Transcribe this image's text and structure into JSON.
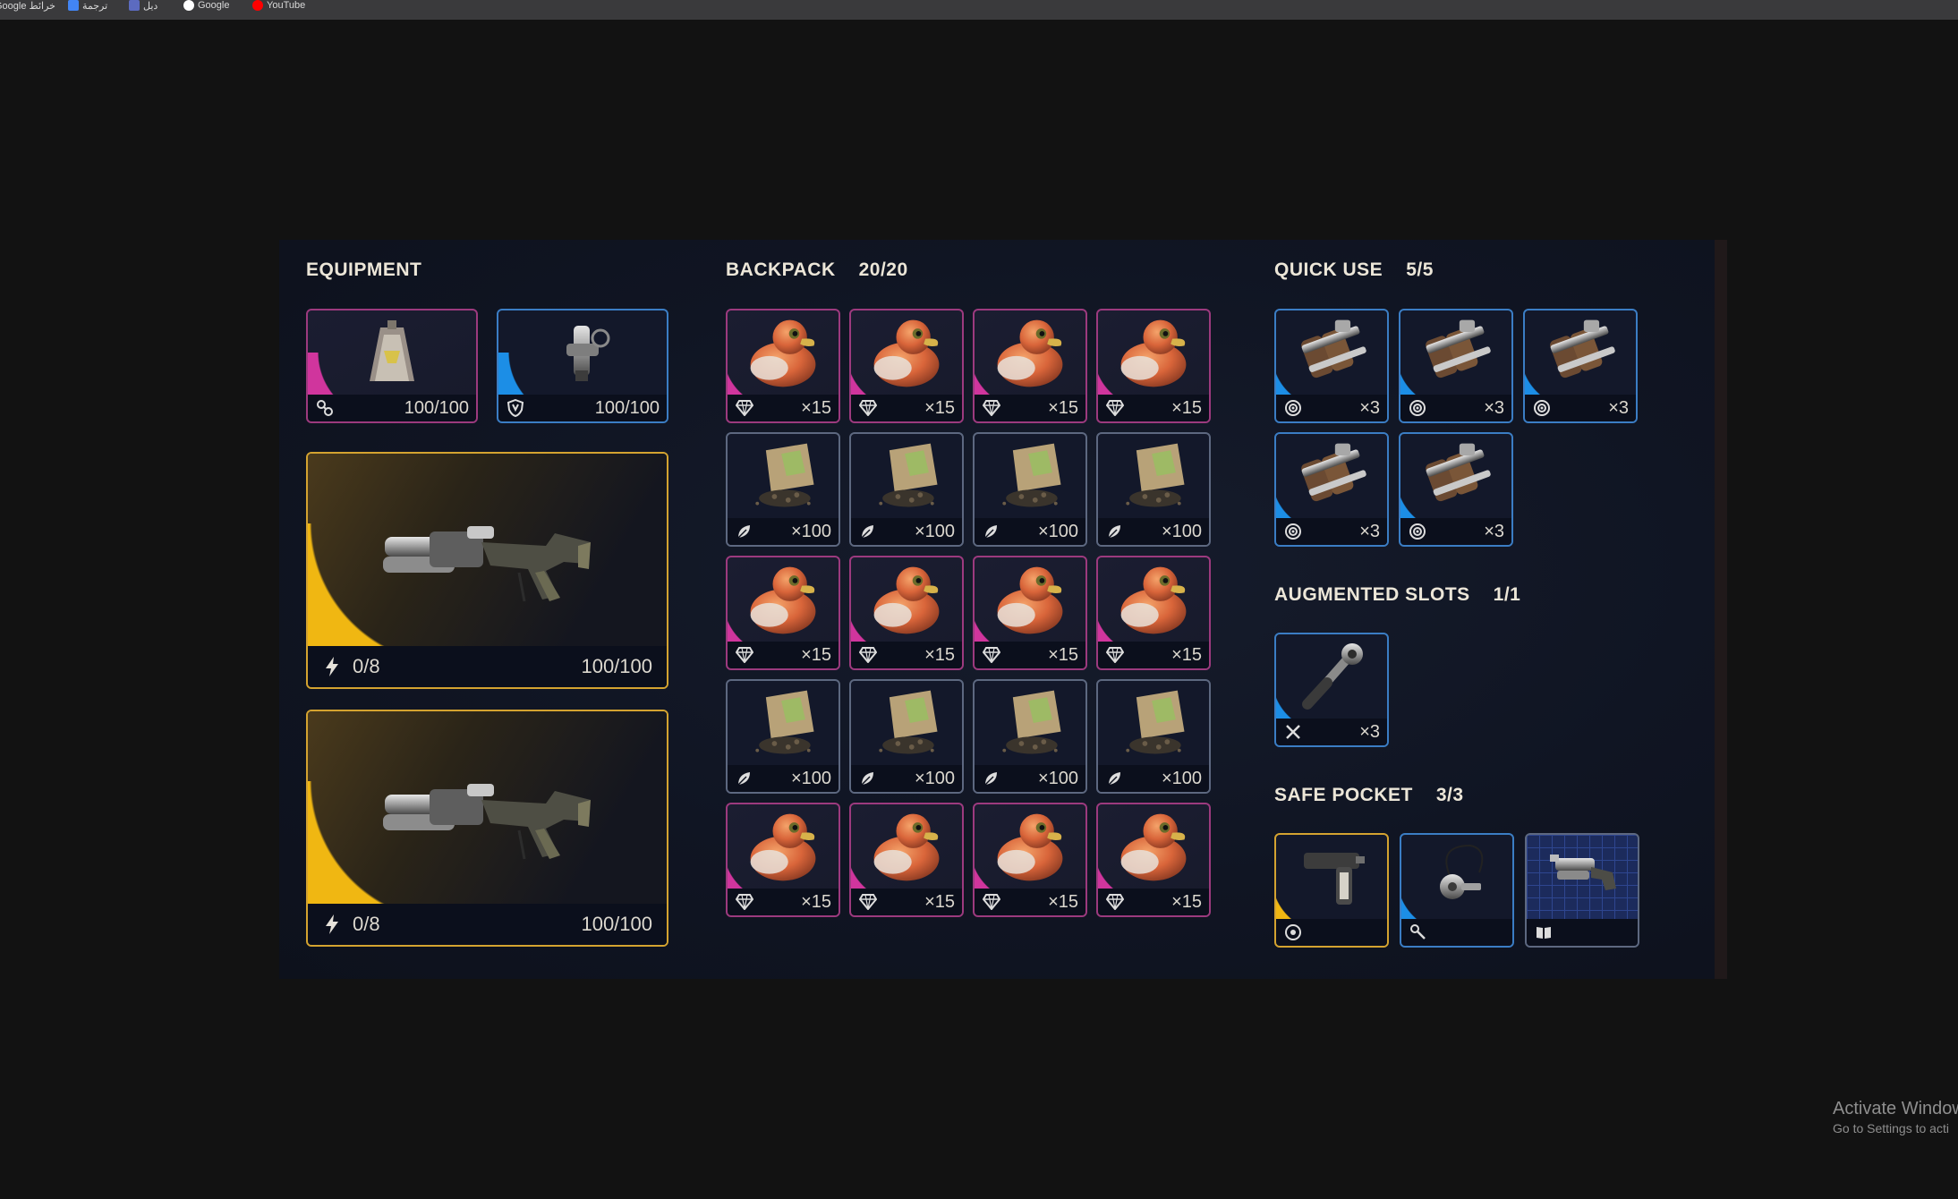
{
  "bookmarks": [
    {
      "label": "Google خرائط",
      "icon": "maps-icon",
      "color": "#4caf50"
    },
    {
      "label": "ترجمة",
      "icon": "translate-icon",
      "color": "#4285f4"
    },
    {
      "label": "ديل",
      "icon": "bookmark-icon",
      "color": "#5c6bc0"
    },
    {
      "label": "Google",
      "icon": "google-icon",
      "color": "#ffffff"
    },
    {
      "label": "YouTube",
      "icon": "youtube-icon",
      "color": "#ff0000"
    }
  ],
  "equipment": {
    "title": "EQUIPMENT",
    "augment": {
      "value": "100/100",
      "icon": "augment-icon",
      "rarity": "pink"
    },
    "shield": {
      "value": "100/100",
      "icon": "shield-icon",
      "rarity": "blue"
    },
    "weapons": [
      {
        "ammo": "0/8",
        "durability": "100/100",
        "icon": "lightning-icon",
        "rarity": "gold"
      },
      {
        "ammo": "0/8",
        "durability": "100/100",
        "icon": "lightning-icon",
        "rarity": "gold"
      }
    ]
  },
  "backpack": {
    "title": "BACKPACK",
    "count": "20/20",
    "rows": [
      [
        {
          "item": "rubber-duck",
          "qty": "×15"
        },
        {
          "item": "rubber-duck",
          "qty": "×15"
        },
        {
          "item": "rubber-duck",
          "qty": "×15"
        },
        {
          "item": "rubber-duck",
          "qty": "×15"
        }
      ],
      [
        {
          "item": "seed-bag",
          "qty": "×100"
        },
        {
          "item": "seed-bag",
          "qty": "×100"
        },
        {
          "item": "seed-bag",
          "qty": "×100"
        },
        {
          "item": "seed-bag",
          "qty": "×100"
        }
      ],
      [
        {
          "item": "rubber-duck",
          "qty": "×15"
        },
        {
          "item": "rubber-duck",
          "qty": "×15"
        },
        {
          "item": "rubber-duck",
          "qty": "×15"
        },
        {
          "item": "rubber-duck",
          "qty": "×15"
        }
      ],
      [
        {
          "item": "seed-bag",
          "qty": "×100"
        },
        {
          "item": "seed-bag",
          "qty": "×100"
        },
        {
          "item": "seed-bag",
          "qty": "×100"
        },
        {
          "item": "seed-bag",
          "qty": "×100"
        }
      ],
      [
        {
          "item": "rubber-duck",
          "qty": "×15"
        },
        {
          "item": "rubber-duck",
          "qty": "×15"
        },
        {
          "item": "rubber-duck",
          "qty": "×15"
        },
        {
          "item": "rubber-duck",
          "qty": "×15"
        }
      ]
    ]
  },
  "quick_use": {
    "title": "QUICK USE",
    "count": "5/5",
    "items": [
      {
        "item": "grenade-pack",
        "qty": "×3"
      },
      {
        "item": "grenade-pack",
        "qty": "×3"
      },
      {
        "item": "grenade-pack",
        "qty": "×3"
      },
      {
        "item": "grenade-pack",
        "qty": "×3"
      },
      {
        "item": "grenade-pack",
        "qty": "×3"
      }
    ]
  },
  "augmented_slots": {
    "title": "AUGMENTED SLOTS",
    "count": "1/1",
    "items": [
      {
        "item": "wrench-tool",
        "qty": "×3"
      }
    ]
  },
  "safe_pocket": {
    "title": "SAFE POCKET",
    "count": "3/3",
    "items": [
      {
        "item": "pistol",
        "rarity": "gold",
        "icon": "ammo-icon"
      },
      {
        "item": "key",
        "rarity": "blue",
        "icon": "key-icon"
      },
      {
        "item": "blueprint",
        "rarity": "slate",
        "icon": "book-icon"
      }
    ]
  },
  "watermark": {
    "line1": "Activate Window",
    "line2": "Go to Settings to acti"
  },
  "colors": {
    "pink": "#d0359d",
    "blue": "#1c8ee6",
    "gold": "#f0b712",
    "panel": "#101523"
  }
}
